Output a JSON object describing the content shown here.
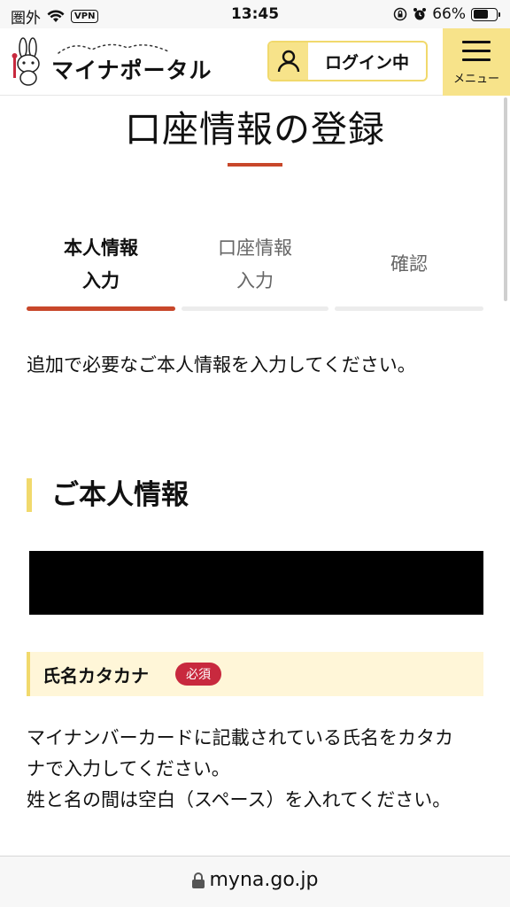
{
  "status_bar": {
    "carrier": "圏外",
    "vpn": "VPN",
    "time": "13:45",
    "battery": "66%",
    "battery_level": 0.66
  },
  "header": {
    "brand": "マイナポータル",
    "login_status": "ログイン中",
    "menu_label": "メニュー"
  },
  "page": {
    "title": "口座情報の登録",
    "steps": [
      {
        "line1": "本人情報",
        "line2": "入力",
        "active": true
      },
      {
        "line1": "口座情報",
        "line2": "入力",
        "active": false
      },
      {
        "line1": "確認",
        "line2": "",
        "active": false
      }
    ],
    "intro": "追加で必要なご本人情報を入力してください。",
    "section_title": "ご本人情報",
    "field": {
      "label": "氏名カタカナ",
      "required_badge": "必須",
      "description_1": "マイナンバーカードに記載されている氏名をカタカナで入力してください。",
      "description_2": "姓と名の間は空白（スペース）を入れてください。"
    }
  },
  "browser": {
    "url": "myna.go.jp"
  },
  "colors": {
    "accent_red": "#c8472a",
    "brand_yellow": "#f7e38a",
    "required_red": "#c8293e"
  }
}
